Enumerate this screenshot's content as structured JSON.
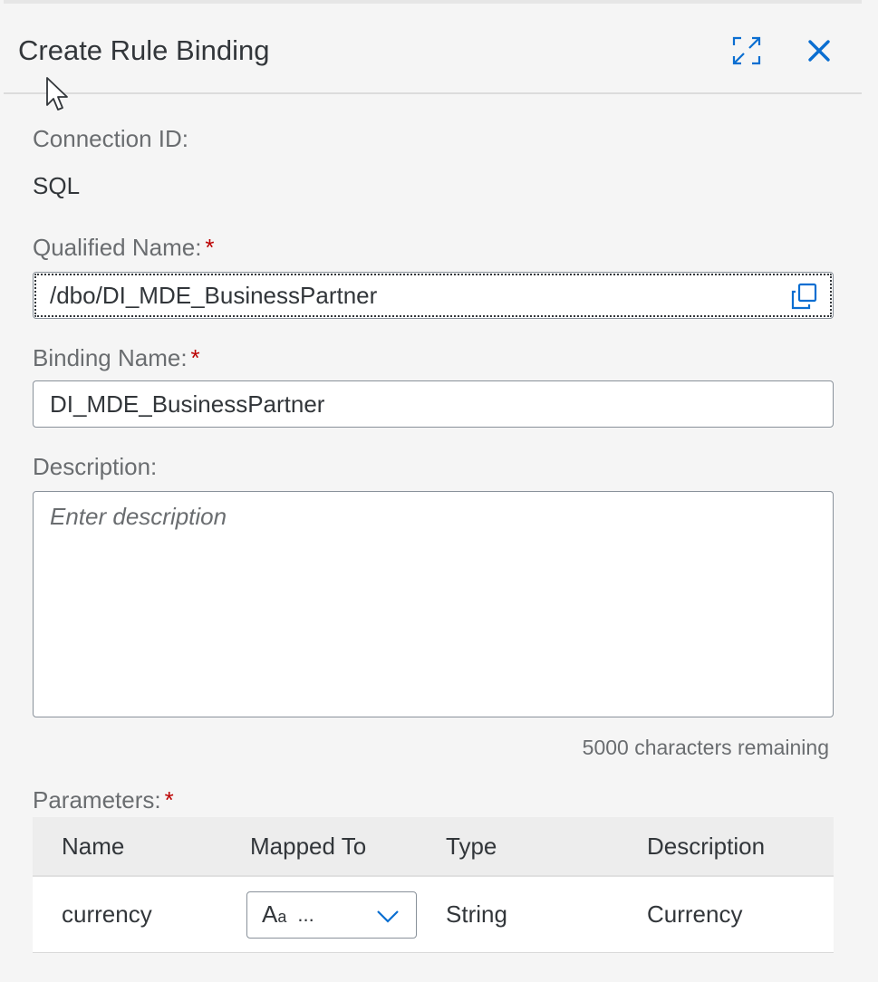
{
  "dialog": {
    "title": "Create Rule Binding",
    "icons": {
      "expand": "expand-icon",
      "close": "close-icon"
    }
  },
  "connection": {
    "label": "Connection ID:",
    "value": "SQL"
  },
  "qualified_name": {
    "label": "Qualified Name:",
    "required": "*",
    "value": "/dbo/DI_MDE_BusinessPartner",
    "icon": "copy-icon"
  },
  "binding_name": {
    "label": "Binding Name:",
    "required": "*",
    "value": "DI_MDE_BusinessPartner"
  },
  "description": {
    "label": "Description:",
    "placeholder": "Enter description",
    "counter": "5000 characters remaining"
  },
  "parameters": {
    "label": "Parameters:",
    "required": "*",
    "columns": [
      "Name",
      "Mapped To",
      "Type",
      "Description"
    ],
    "rows": [
      {
        "name": "currency",
        "mapped_to_main": "A",
        "mapped_to_sub": "a",
        "mapped_to_ellipsis": "...",
        "type": "String",
        "description": "Currency"
      }
    ]
  },
  "colors": {
    "accent": "#0a6ed1",
    "required": "#bb0000",
    "text": "#32363a",
    "label": "#6a6d70"
  }
}
